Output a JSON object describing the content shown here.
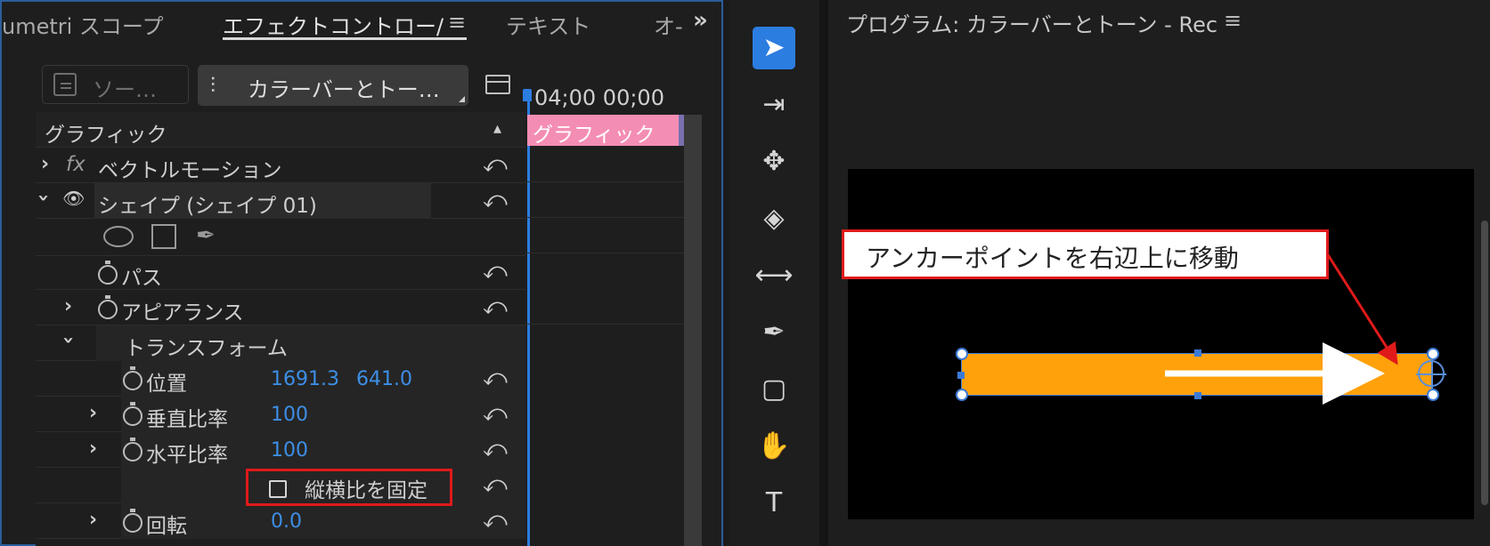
{
  "tabs": {
    "lumetri": "umetri スコープ",
    "effect_controls": "エフェクトコントロー/",
    "effect_menu": "≡",
    "text": "テキスト",
    "overflow": "オ-",
    "more": "»"
  },
  "effect_controls": {
    "source_label": "ソー…",
    "clip_label": "カラーバーとトー…",
    "timecode": "04;00 00;00",
    "timeline_clip_label": "グラフィック",
    "section_header": "グラフィック",
    "rows": [
      {
        "label": "ベクトルモーション",
        "fx": "fx"
      },
      {
        "label": "シェイプ (シェイプ 01)"
      },
      {
        "label": "パス"
      },
      {
        "label": "アピアランス"
      },
      {
        "label": "トランスフォーム"
      },
      {
        "label": "位置",
        "value_x": "1691.3",
        "value_y": "641.0"
      },
      {
        "label": "垂直比率",
        "value": "100"
      },
      {
        "label": "水平比率",
        "value": "100"
      },
      {
        "label": "縦横比を固定"
      },
      {
        "label": "回転",
        "value": "0.0"
      }
    ],
    "reset_icon": "⤺"
  },
  "tools": [
    "select-tool",
    "track-select-tool",
    "ripple-edit-tool",
    "razor-tool",
    "slip-tool",
    "pen-tool",
    "rectangle-tool",
    "hand-tool",
    "type-tool"
  ],
  "program": {
    "title": "プログラム: カラーバーとトーン - Rec 7(",
    "menu": "≡",
    "annotation": "アンカーポイントを右辺上に移動",
    "shape_color": "#ffa10a",
    "annotation_color": "#e01a1a"
  }
}
